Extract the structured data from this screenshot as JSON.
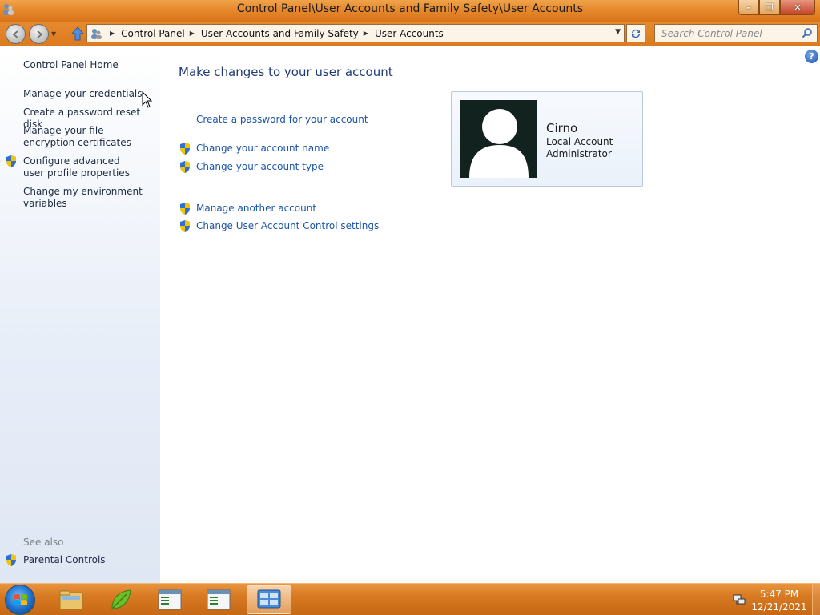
{
  "window": {
    "title": "Control Panel\\User Accounts and Family Safety\\User Accounts",
    "minimize_label": "–",
    "maximize_label": "❐",
    "close_label": "✕"
  },
  "nav": {
    "breadcrumb": [
      "Control Panel",
      "User Accounts and Family Safety",
      "User Accounts"
    ],
    "search_placeholder": "Search Control Panel"
  },
  "sidebar": {
    "home": "Control Panel Home",
    "links": [
      "Manage your credentials",
      "Create a password reset disk",
      "Manage your file encryption certificates",
      "Configure advanced user profile properties",
      "Change my environment variables"
    ],
    "see_also_title": "See also",
    "see_also": [
      "Parental Controls"
    ]
  },
  "main": {
    "heading": "Make changes to your user account",
    "tasks": [
      "Create a password for your account",
      "Change your account name",
      "Change your account type",
      "Manage another account",
      "Change User Account Control settings"
    ],
    "account": {
      "name": "Cirno",
      "type": "Local Account",
      "role": "Administrator"
    }
  },
  "taskbar": {
    "time": "5:47 PM",
    "date": "12/21/2021"
  },
  "colors": {
    "accent": "#d97418",
    "link": "#1c56a8",
    "heading": "#1f3a75"
  }
}
